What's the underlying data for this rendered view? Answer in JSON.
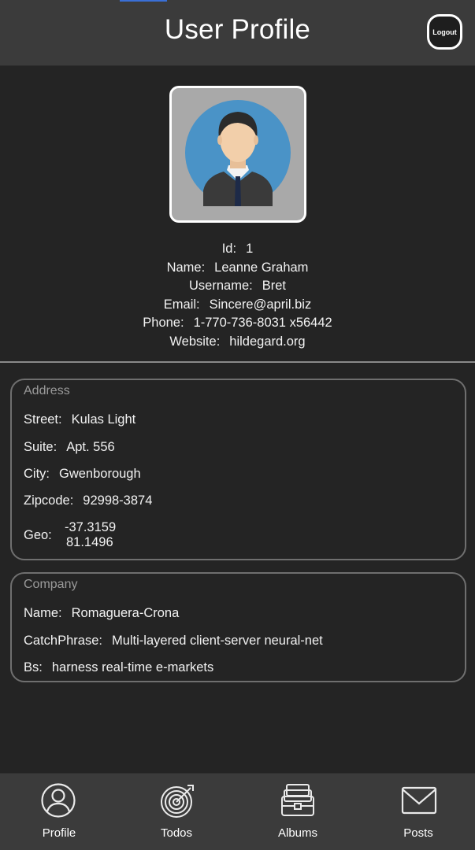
{
  "header": {
    "title": "User Profile",
    "logout_label": "Logout"
  },
  "profile": {
    "avatar_icon": "man-in-suit-avatar-icon",
    "id_label": "Id:",
    "id_value": "1",
    "name_label": "Name:",
    "name_value": "Leanne Graham",
    "username_label": "Username:",
    "username_value": "Bret",
    "email_label": "Email:",
    "email_value": "Sincere@april.biz",
    "phone_label": "Phone:",
    "phone_value": "1-770-736-8031 x56442",
    "website_label": "Website:",
    "website_value": "hildegard.org"
  },
  "address": {
    "title": "Address",
    "street_label": "Street:",
    "street_value": "Kulas Light",
    "suite_label": "Suite:",
    "suite_value": "Apt. 556",
    "city_label": "City:",
    "city_value": "Gwenborough",
    "zipcode_label": "Zipcode:",
    "zipcode_value": "92998-3874",
    "geo_label": "Geo:",
    "geo_lat": "-37.3159",
    "geo_lng": "81.1496"
  },
  "company": {
    "title": "Company",
    "name_label": "Name:",
    "name_value": "Romaguera-Crona",
    "catchphrase_label": "CatchPhrase:",
    "catchphrase_value": "Multi-layered client-server neural-net",
    "bs_label": "Bs:",
    "bs_value": "harness real-time e-markets"
  },
  "tabs": [
    {
      "label": "Profile",
      "icon": "person-circle-icon"
    },
    {
      "label": "Todos",
      "icon": "target-icon"
    },
    {
      "label": "Albums",
      "icon": "photo-album-icon"
    },
    {
      "label": "Posts",
      "icon": "envelope-icon"
    }
  ],
  "colors": {
    "background": "#242424",
    "bar": "#3b3b3b",
    "text": "#f2f2f2",
    "card_border": "#6f6f6f",
    "accent": "#3a6fd6"
  }
}
